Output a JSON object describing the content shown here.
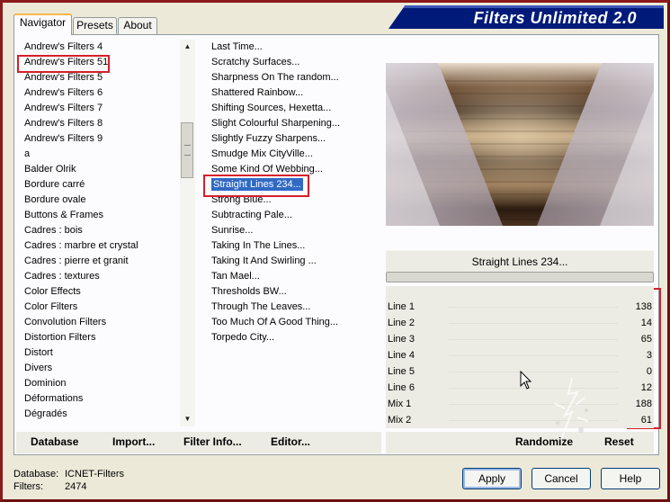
{
  "app_title": "Filters Unlimited 2.0",
  "tabs": [
    {
      "label": "Navigator",
      "active": true
    },
    {
      "label": "Presets",
      "active": false
    },
    {
      "label": "About",
      "active": false
    }
  ],
  "categories": [
    "Andrew's Filters 4",
    "Andrew's Filters 51",
    "Andrew's Filters 5",
    "Andrew's Filters 6",
    "Andrew's Filters 7",
    "Andrew's Filters 8",
    "Andrew's Filters 9",
    "a",
    "Balder Olrik",
    "Bordure carré",
    "Bordure ovale",
    "Buttons & Frames",
    "Cadres : bois",
    "Cadres : marbre et crystal",
    "Cadres : pierre et granit",
    "Cadres : textures",
    "Color Effects",
    "Color Filters",
    "Convolution Filters",
    "Distortion Filters",
    "Distort",
    "Divers",
    "Dominion",
    "Déformations",
    "Dégradés"
  ],
  "selected_category": "Andrew's Filters 51",
  "filters": [
    "Last Time...",
    "Scratchy Surfaces...",
    "Sharpness On The random...",
    "Shattered Rainbow...",
    "Shifting Sources, Hexetta...",
    "Slight Colourful Sharpening...",
    "Slightly Fuzzy Sharpens...",
    "Smudge Mix CityVille...",
    "Some Kind Of Webbing...",
    "Straight Lines 234...",
    "Strong Blue...",
    "Subtracting Pale...",
    "Sunrise...",
    "Taking In The Lines...",
    "Taking It And Swirling ...",
    "Tan Mael...",
    "Thresholds BW...",
    "Through The Leaves...",
    "Too Much Of A Good Thing...",
    "Torpedo City..."
  ],
  "selected_filter": "Straight Lines 234...",
  "params": [
    {
      "label": "Line 1",
      "value": "138"
    },
    {
      "label": "Line 2",
      "value": "14"
    },
    {
      "label": "Line 3",
      "value": "65"
    },
    {
      "label": "Line 4",
      "value": "3"
    },
    {
      "label": "Line 5",
      "value": "0"
    },
    {
      "label": "Line 6",
      "value": "12"
    },
    {
      "label": "Mix 1",
      "value": "188"
    },
    {
      "label": "Mix 2",
      "value": "61"
    }
  ],
  "bottom_links": {
    "database": "Database",
    "import": "Import...",
    "filter_info": "Filter Info...",
    "editor": "Editor...",
    "randomize": "Randomize",
    "reset": "Reset"
  },
  "status": {
    "database_label": "Database:",
    "database_value": "ICNET-Filters",
    "filters_label": "Filters:",
    "filters_value": "2474"
  },
  "buttons": {
    "apply": "Apply",
    "cancel": "Cancel",
    "help": "Help"
  },
  "colors": {
    "highlight_red": "#d4202a",
    "selection_blue": "#316ac5",
    "banner_blue": "#001a7a"
  }
}
